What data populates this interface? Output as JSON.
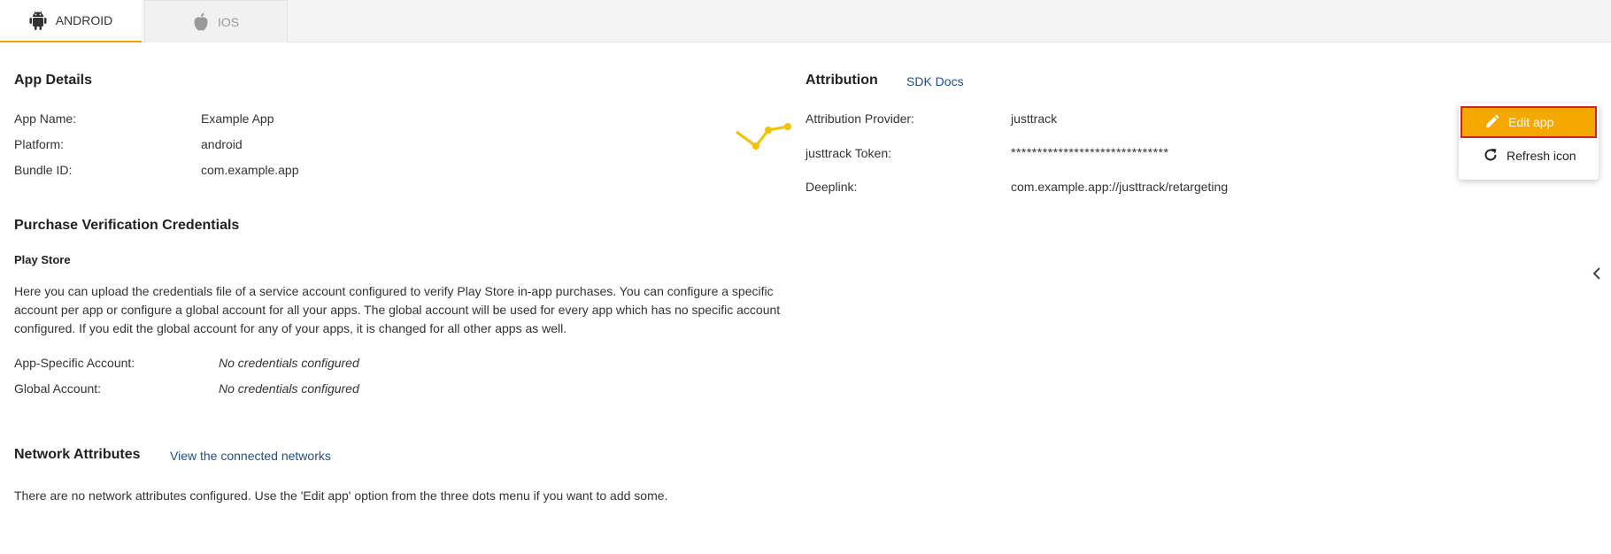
{
  "tabs": [
    {
      "label": "ANDROID",
      "icon": "android-icon"
    },
    {
      "label": "IOS",
      "icon": "apple-icon"
    }
  ],
  "app_details": {
    "title": "App Details",
    "rows": [
      {
        "label": "App Name:",
        "value": "Example App"
      },
      {
        "label": "Platform:",
        "value": "android"
      },
      {
        "label": "Bundle ID:",
        "value": "com.example.app"
      }
    ]
  },
  "attribution": {
    "title": "Attribution",
    "sdk_docs": "SDK Docs",
    "rows": [
      {
        "label": "Attribution Provider:",
        "value": "justtrack"
      },
      {
        "label": "justtrack Token:",
        "value": "******************************"
      },
      {
        "label": "Deeplink:",
        "value": "com.example.app://justtrack/retargeting"
      }
    ]
  },
  "purchase": {
    "title": "Purchase Verification Credentials",
    "subtitle": "Play Store",
    "description_lines": [
      "Here you can upload the credentials file of a service account configured to verify Play Store in-app purchases. You can configure a specific",
      "account per app or configure a global account for all your apps. The global account will be used for every app which has no specific account",
      "configured. If you edit the global account for any of your apps, it is changed for all other apps as well."
    ],
    "rows": [
      {
        "label": "App-Specific Account:",
        "value": "No credentials configured"
      },
      {
        "label": "Global Account:",
        "value": "No credentials configured"
      }
    ]
  },
  "network": {
    "title": "Network Attributes",
    "link": "View the connected networks",
    "empty_text": "There are no network attributes configured. Use the 'Edit app' option from the three dots menu if you want to add some."
  },
  "menu": {
    "edit_label": "Edit app",
    "refresh_label": "Refresh icon"
  },
  "colors": {
    "accent": "#f5a800",
    "link": "#1d4e8f",
    "highlight_border": "#d0202a"
  }
}
